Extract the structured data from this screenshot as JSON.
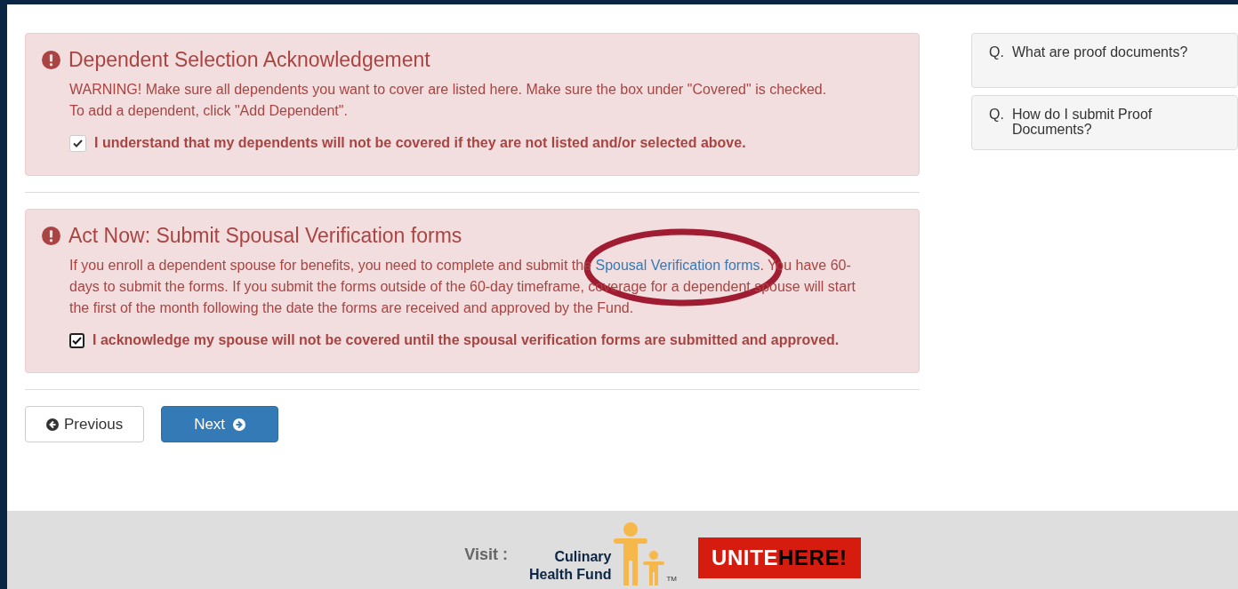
{
  "alerts": [
    {
      "title": "Dependent Selection Acknowledgement",
      "paragraphs": [
        {
          "text": "WARNING! Make sure all dependents you want to cover are listed here. Make sure the box under \"Covered\" is checked."
        },
        {
          "text": "To add a dependent, click \"Add Dependent\"."
        }
      ],
      "checkbox": {
        "label": "I understand that my dependents will not be covered if they are not listed and/or selected above.",
        "checked": true,
        "kind": "rounded"
      }
    },
    {
      "title": "Act Now: Submit Spousal Verification forms",
      "paragraphs": [
        {
          "text": "If you enroll a dependent spouse for benefits, you need to complete and submit the ",
          "link": "Spousal Verification forms",
          "after": ". You have 60-days to submit the forms. If you submit the forms outside of the 60-day timeframe, coverage for a dependent spouse will start the first of the month following the date the forms are received and approved by the Fund.",
          "highlighted": true
        }
      ],
      "checkbox": {
        "label": "I acknowledge my spouse will not be covered until the spousal verification forms are submitted and approved.",
        "checked": true,
        "kind": "square"
      }
    }
  ],
  "buttons": [
    {
      "label": "Previous",
      "kind": "default"
    },
    {
      "label": "Next",
      "kind": "primary"
    }
  ],
  "faq": [
    {
      "prefix": "Q.",
      "question": "What are proof documents?"
    },
    {
      "prefix": "Q.",
      "question": "How do I submit Proof Documents?"
    }
  ],
  "footer": {
    "label": "Visit :",
    "logo_lines": [
      "Culinary",
      "Health Fund"
    ],
    "logo_tm": "TM",
    "union_logo": [
      "UNITE",
      "HERE!"
    ]
  }
}
